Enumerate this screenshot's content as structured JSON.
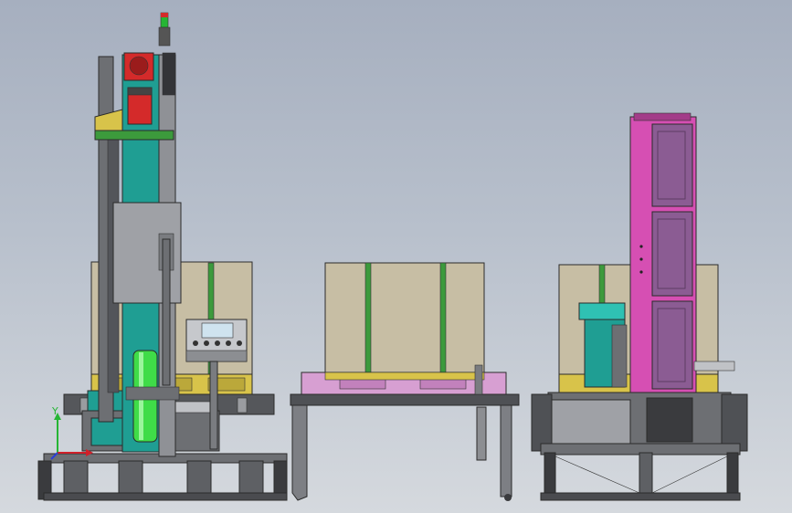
{
  "viewport": {
    "background_top": "#a6afbf",
    "background_bottom": "#d5d9de"
  },
  "palette": {
    "teal": "#1f9e93",
    "pink": "#d64fb3",
    "purple_panel": "#8b5c93",
    "box_tan": "#c7bea4",
    "strap_green": "#3c9a3c",
    "film_green": "#3fdc48",
    "frame_gray": "#6d6f73",
    "dark_frame": "#3a3b3e",
    "motor_red": "#d42a2a",
    "yellow": "#d8c34a",
    "pallet_violet": "#d79fd2"
  },
  "triad": {
    "y_label": "Y",
    "x_color": "#d0202a",
    "y_color": "#26b534",
    "z_color": "#2b3fd6"
  },
  "control_panel": {
    "display_color": "#cfe3ef",
    "button_count": 5
  },
  "stations": [
    {
      "name": "stretch-wrapper",
      "type": "wrapping-machine"
    },
    {
      "name": "conveyor-table",
      "type": "transfer-conveyor"
    },
    {
      "name": "strapping-machine",
      "type": "strapping-machine"
    }
  ]
}
